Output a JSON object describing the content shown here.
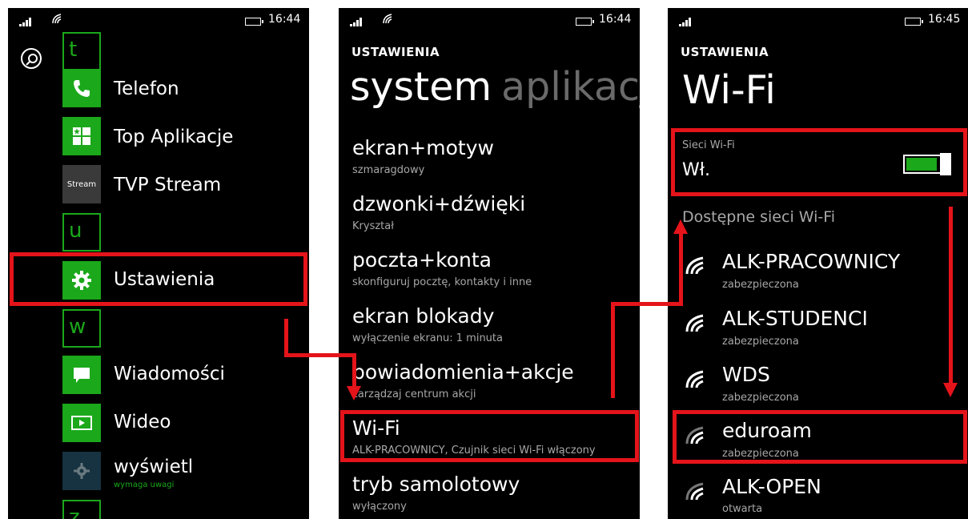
{
  "screen1": {
    "time": "16:44",
    "letters": {
      "t": "t",
      "u": "u",
      "w": "w",
      "z": "z"
    },
    "apps": [
      {
        "label": "Telefon",
        "icon": "phone-icon"
      },
      {
        "label": "Top Aplikacje",
        "icon": "store-icon"
      },
      {
        "label": "TVP Stream",
        "icon": "tvp-stream-icon",
        "icon_text": "Stream"
      },
      {
        "label": "Ustawienia",
        "icon": "gear-icon"
      },
      {
        "label": "Wiadomości",
        "icon": "message-icon"
      },
      {
        "label": "Wideo",
        "icon": "video-icon"
      },
      {
        "label": "wyświetl",
        "icon": "gear-icon",
        "sub": "wymaga uwagi"
      }
    ]
  },
  "screen2": {
    "time": "16:44",
    "header": "USTAWIENIA",
    "pivot_active": "system",
    "pivot_inactive": "aplikacj",
    "items": [
      {
        "title": "ekran+motyw",
        "sub": "szmaragdowy"
      },
      {
        "title": "dzwonki+dźwięki",
        "sub": "Kryształ"
      },
      {
        "title": "poczta+konta",
        "sub": "skonfiguruj pocztę, kontakty i inne"
      },
      {
        "title": "ekran blokady",
        "sub": "wyłączenie ekranu: 1 minuta"
      },
      {
        "title": "powiadomienia+akcje",
        "sub": "zarządzaj centrum akcji"
      },
      {
        "title": "Wi-Fi",
        "sub": "ALK-PRACOWNICY, Czujnik sieci Wi-Fi włączony"
      },
      {
        "title": "tryb samolotowy",
        "sub": "wyłączony"
      }
    ]
  },
  "screen3": {
    "time": "16:45",
    "header": "USTAWIENIA",
    "title": "Wi-Fi",
    "wifi_label": "Sieci Wi-Fi",
    "wifi_state": "Wł.",
    "toggle_on": true,
    "available_label": "Dostępne sieci Wi-Fi",
    "networks": [
      {
        "name": "ALK-PRACOWNICY",
        "status": "zabezpieczona"
      },
      {
        "name": "ALK-STUDENCI",
        "status": "zabezpieczona"
      },
      {
        "name": "WDS",
        "status": "zabezpieczona"
      },
      {
        "name": "eduroam",
        "status": "zabezpieczona"
      },
      {
        "name": "ALK-OPEN",
        "status": "otwarta"
      }
    ]
  },
  "colors": {
    "accent": "#1ba81b",
    "highlight": "#e4141a"
  }
}
